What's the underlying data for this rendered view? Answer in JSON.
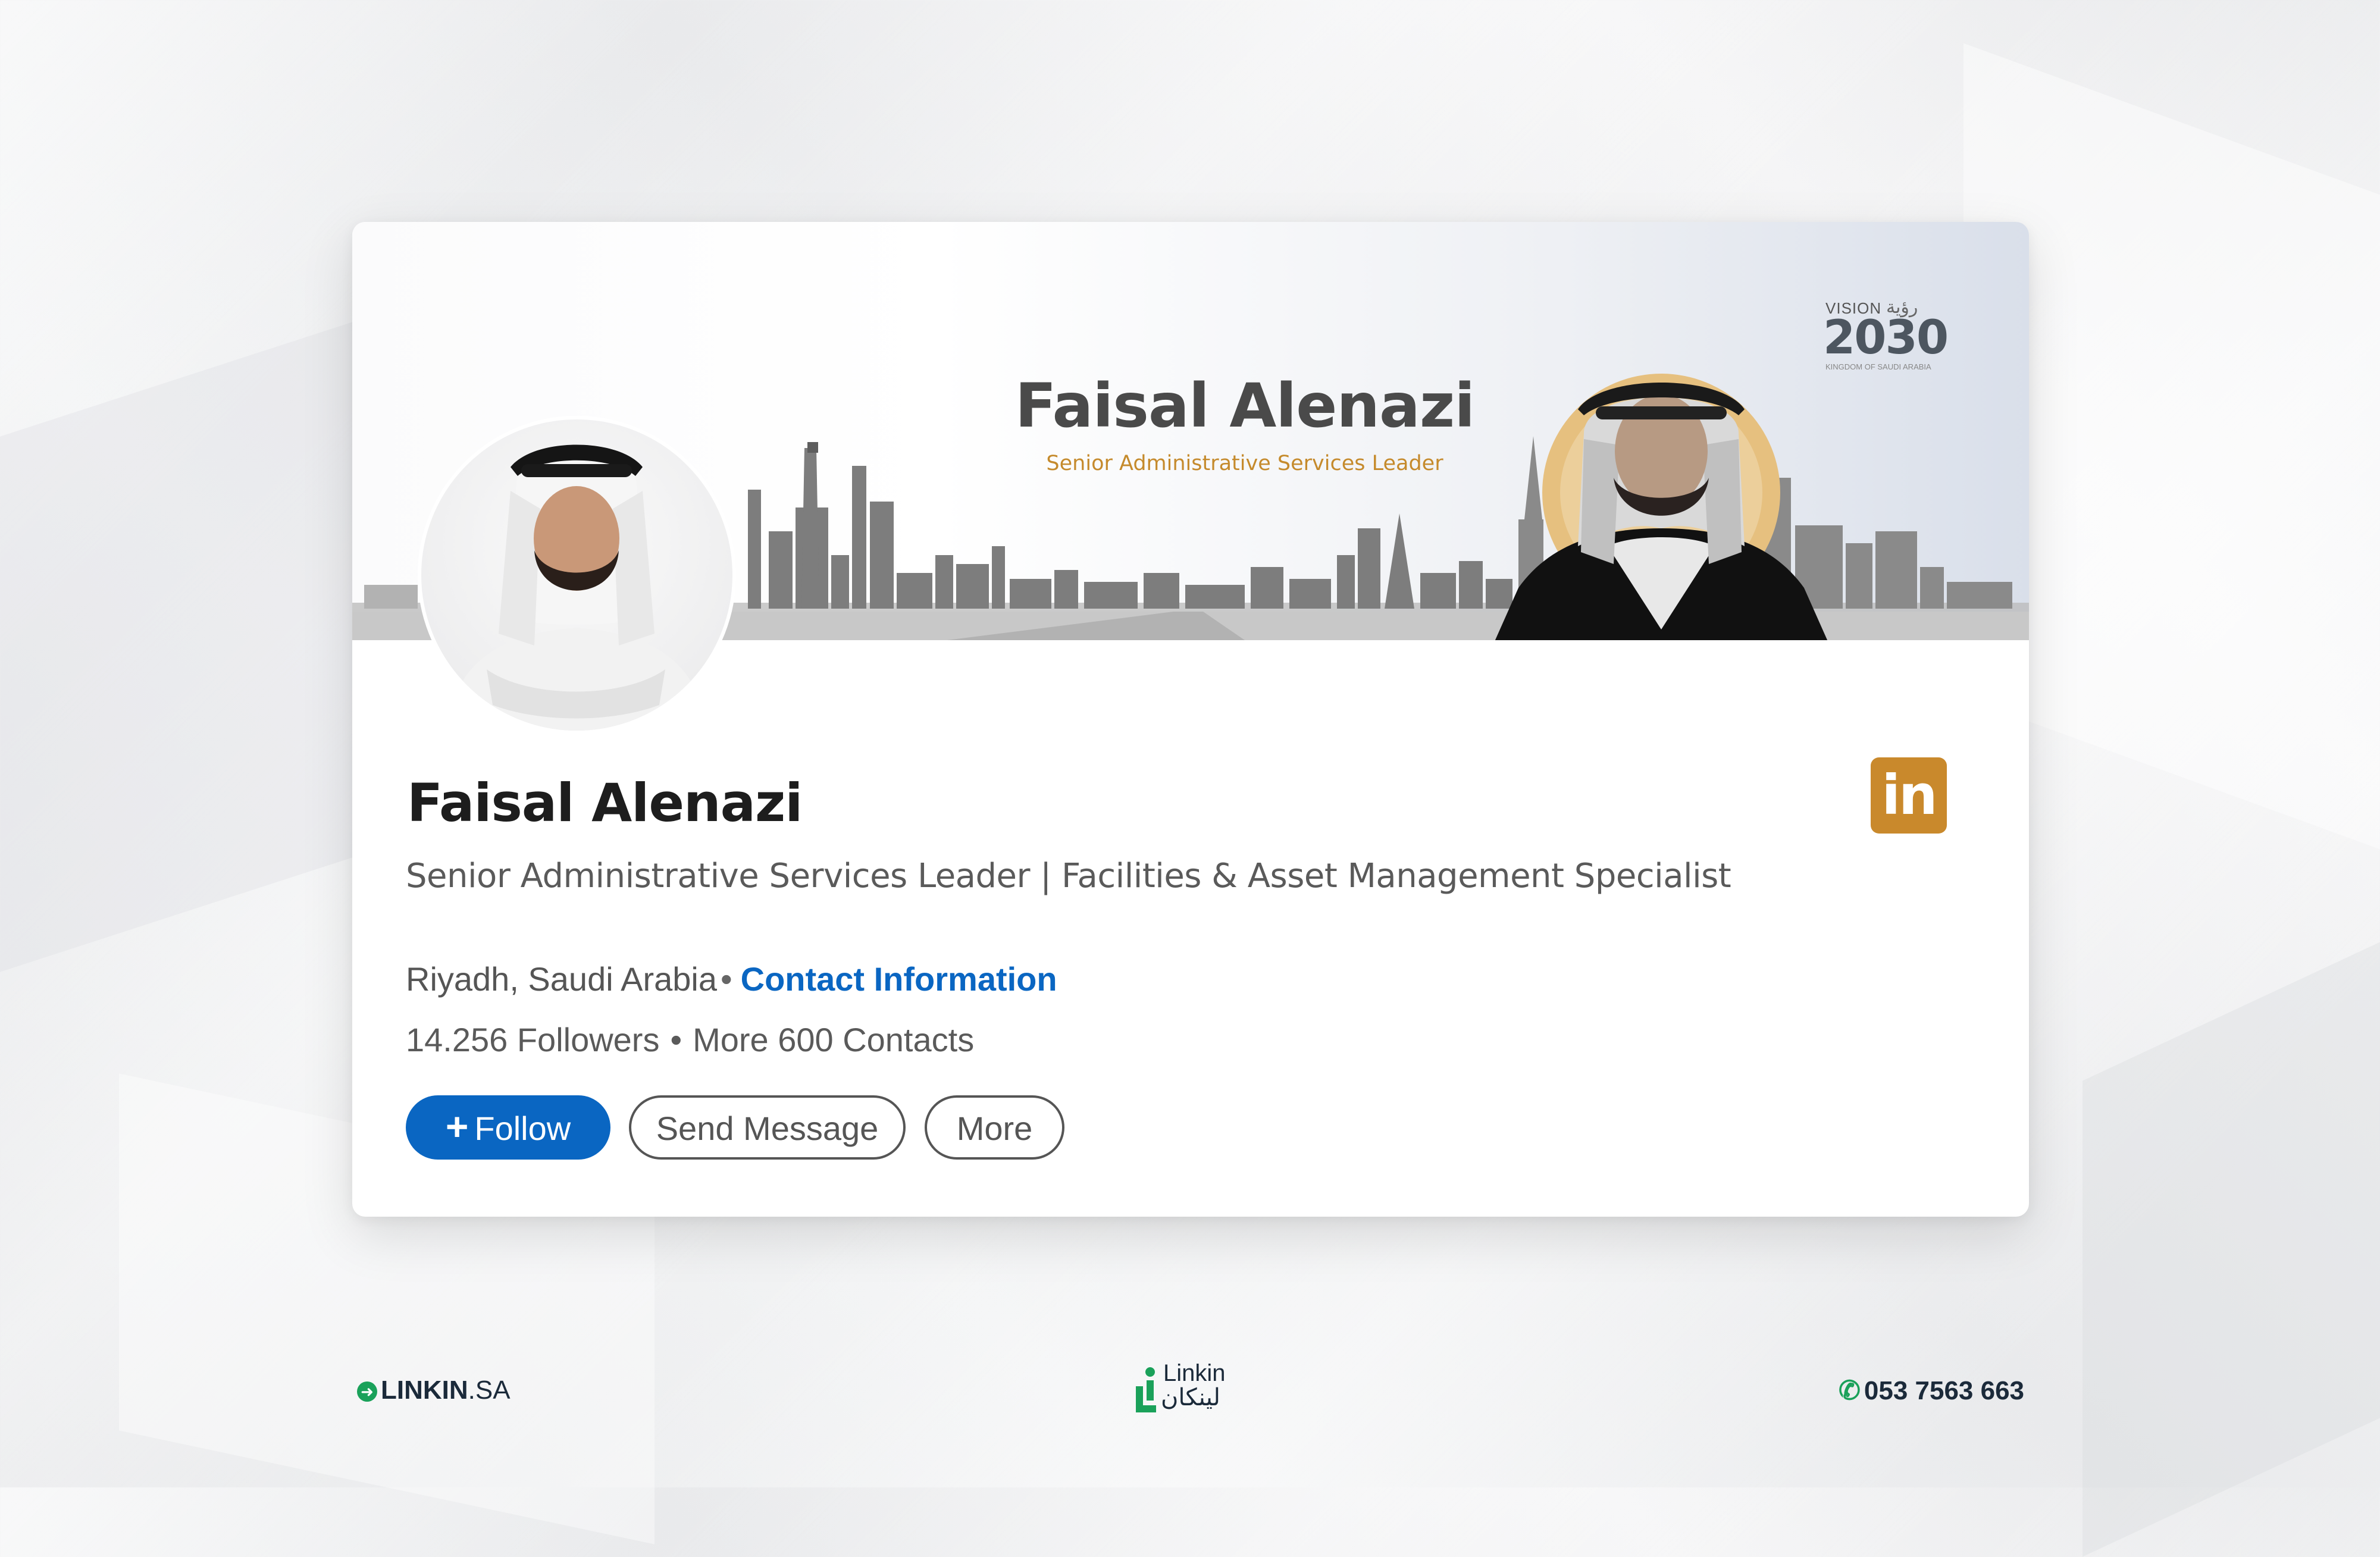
{
  "banner": {
    "name": "Faisal Alenazi",
    "subtitle": "Senior Administrative Services Leader",
    "vision_logo": {
      "top": "VISION",
      "arabic_top": "رؤية",
      "year": "2030",
      "bottom": "KINGDOM OF SAUDI ARABIA"
    }
  },
  "profile": {
    "name": "Faisal Alenazi",
    "headline": "Senior Administrative Services Leader | Facilities & Asset Management Specialist",
    "location": "Riyadh, Saudi Arabia",
    "separator": "•",
    "contact_link": "Contact Information",
    "followers": "14.256 Followers",
    "contacts": "More 600 Contacts",
    "linkedin_badge": "in"
  },
  "actions": {
    "follow_icon": "+",
    "follow": "Follow",
    "message": "Send Message",
    "more": "More"
  },
  "footer": {
    "website_brand": "LINKIN",
    "website_tld": ".SA",
    "logo_en": "Linkin",
    "logo_ar": "لينكان",
    "phone": "053 7563 663"
  },
  "colors": {
    "accent_blue": "#0a66c2",
    "gold": "#c9892c",
    "green": "#1aa15a"
  },
  "icons": [
    "arrow-right-circle-icon",
    "phone-icon",
    "linkedin-icon",
    "plus-icon"
  ]
}
